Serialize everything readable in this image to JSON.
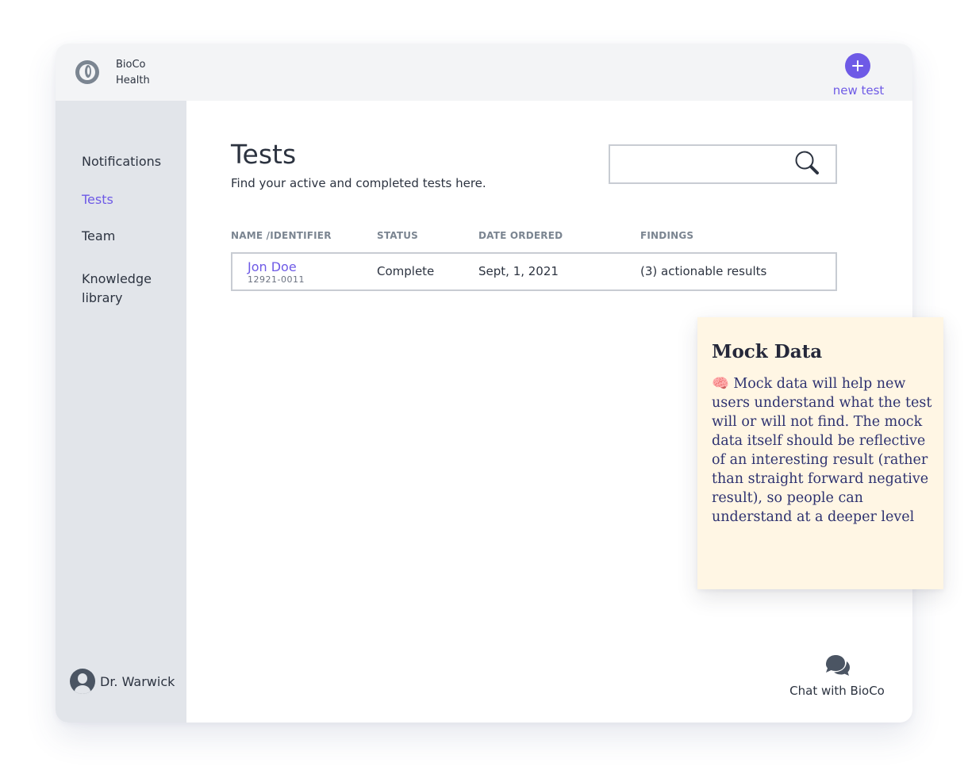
{
  "app": {
    "brand_line1": "BioCo",
    "brand_line2": "Health"
  },
  "header": {
    "new_test_label": "new test"
  },
  "sidebar": {
    "items": [
      {
        "label": "Notifications",
        "active": false
      },
      {
        "label": "Tests",
        "active": true
      },
      {
        "label": "Team",
        "active": false
      },
      {
        "label": "Knowledge library",
        "active": false
      }
    ],
    "user": {
      "name": "Dr. Warwick"
    }
  },
  "main": {
    "title": "Tests",
    "subtitle": "Find your active and completed tests here.",
    "search": {
      "value": "",
      "placeholder": ""
    },
    "table": {
      "columns": [
        "NAME /IDENTIFIER",
        "STATUS",
        "DATE ORDERED",
        "FINDINGS"
      ],
      "rows": [
        {
          "name": "Jon Doe",
          "identifier": "12921-0011",
          "status": "Complete",
          "date_ordered": "Sept, 1, 2021",
          "findings": "(3) actionable results"
        }
      ]
    },
    "chat_label": "Chat with BioCo"
  },
  "note": {
    "title": "Mock Data",
    "body": "🧠 Mock data will help new users understand what the test will or will not find. The mock data itself should be reflective of an interesting result (rather than straight forward negative result), so people can understand at a deeper level"
  },
  "colors": {
    "accent": "#6e5ae6",
    "sidebar_bg": "#e2e5ea",
    "header_bg": "#f3f4f6",
    "note_bg": "#fff6e4",
    "text": "#2c3340"
  },
  "icons": {
    "logo": "bioco-logo-icon",
    "new_test": "plus-icon",
    "search": "search-icon",
    "user": "user-avatar-icon",
    "chat": "chat-bubbles-icon"
  }
}
